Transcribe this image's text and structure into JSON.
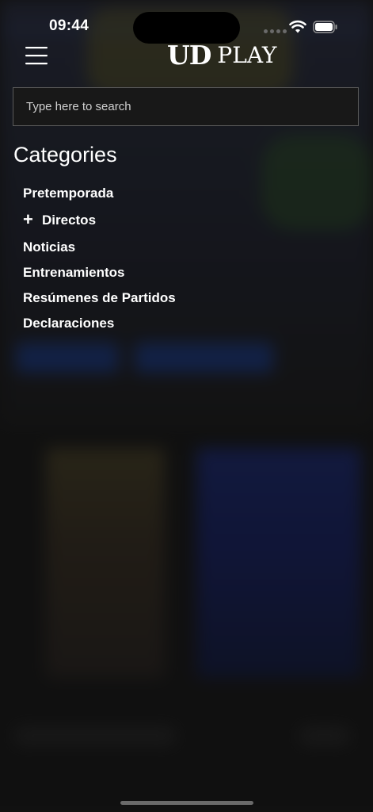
{
  "status_bar": {
    "time": "09:44",
    "wifi_icon": "wifi-icon",
    "battery_icon": "battery-icon"
  },
  "header": {
    "menu_icon": "hamburger-menu-icon",
    "logo_ud": "UD",
    "logo_play": "PLAY"
  },
  "search": {
    "placeholder": "Type here to search",
    "value": ""
  },
  "categories": {
    "title": "Categories",
    "items": [
      {
        "label": "Pretemporada",
        "expandable": false
      },
      {
        "label": "Directos",
        "expandable": true,
        "expand_icon": "plus-icon"
      },
      {
        "label": "Noticias",
        "expandable": false
      },
      {
        "label": "Entrenamientos",
        "expandable": false
      },
      {
        "label": "Resúmenes de Partidos",
        "expandable": false
      },
      {
        "label": "Declaraciones",
        "expandable": false
      }
    ]
  },
  "colors": {
    "background": "#161616",
    "accent_blue": "#1a3a8a",
    "text": "#ffffff",
    "search_border": "#5a5a5a"
  }
}
